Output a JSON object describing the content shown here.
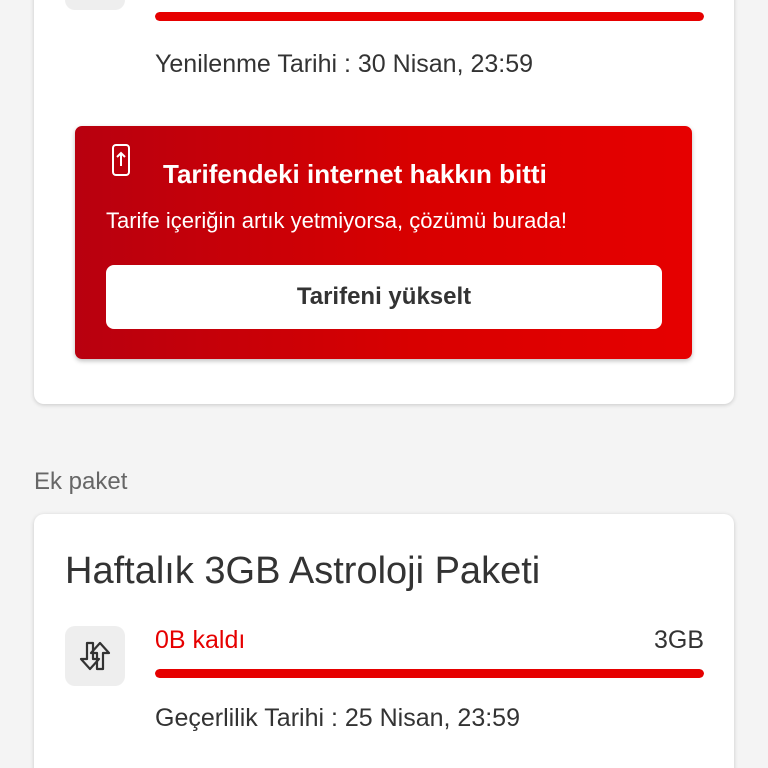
{
  "tariff_card": {
    "icon": "data-transfer-icon",
    "usage_fraction": 1.0,
    "renewal_text": "Yenilenme Tarihi : 30 Nisan, 23:59"
  },
  "promo": {
    "icon": "phone-upgrade-icon",
    "title": "Tarifendeki internet hakkın bitti",
    "description": "Tarife içeriğin artık yetmiyorsa, çözümü burada!",
    "button_label": "Tarifeni yükselt",
    "color": "#e60000"
  },
  "addon_section": {
    "label": "Ek paket"
  },
  "addon_card": {
    "title": "Haftalık 3GB Astroloji Paketi",
    "icon": "data-transfer-icon",
    "remaining_text": "0B kaldı",
    "total_text": "3GB",
    "usage_fraction": 1.0,
    "validity_text": "Geçerlilik Tarihi : 25 Nisan, 23:59"
  },
  "colors": {
    "accent": "#e60000",
    "background": "#f4f4f4",
    "card": "#ffffff"
  }
}
